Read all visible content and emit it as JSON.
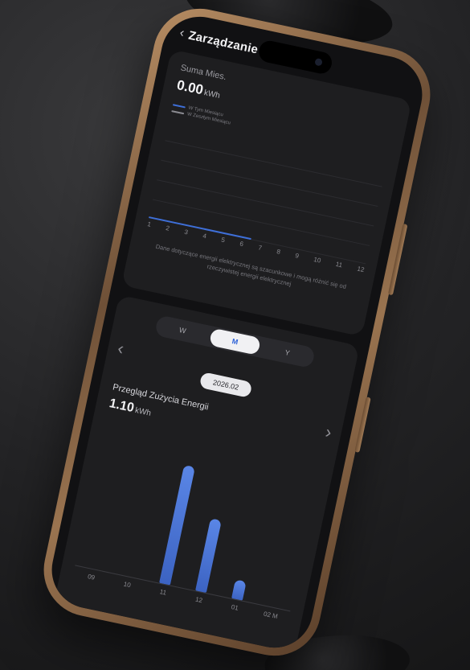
{
  "header": {
    "back_icon": "chevron-left-icon",
    "title": "Zarządzanie"
  },
  "monthly_card": {
    "sum_label": "Suma Mies.",
    "sum_value": "0.00",
    "sum_unit": "kWh",
    "legend": [
      {
        "label": "W Tym Miesiącu",
        "color": "#3e6fd8"
      },
      {
        "label": "W Zeszłym Miesiącu",
        "color": "#8a8a90"
      }
    ],
    "months": [
      "1",
      "2",
      "3",
      "4",
      "5",
      "6",
      "7",
      "8",
      "9",
      "10",
      "11",
      "12"
    ],
    "note": "Dane dotyczące energii elektrycznej są szacunkowe i mogą różnić się od rzeczywistej energii elektrycznej"
  },
  "usage_card": {
    "segments": [
      "W",
      "M",
      "Y"
    ],
    "active_segment": "M",
    "prev_icon": "chevron-left-icon",
    "next_icon": "chevron-right-icon",
    "period": "2026.02",
    "title": "Przegląd Zużycia Energii",
    "value": "1.10",
    "unit": "kWh",
    "accent": "#4a74d6"
  },
  "chart_data": {
    "type": "bar",
    "categories": [
      "09",
      "10",
      "11",
      "12",
      "01",
      "02"
    ],
    "values": [
      0,
      0,
      0.62,
      0.38,
      0.1,
      0
    ],
    "xlabel": "",
    "ylabel": "",
    "x_axis_suffix": "M",
    "grid": false
  }
}
